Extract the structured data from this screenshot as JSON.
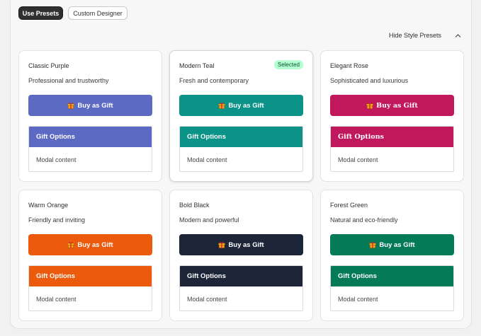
{
  "toolbar": {
    "use_presets_label": "Use Presets",
    "custom_designer_label": "Custom Designer"
  },
  "presets_header": {
    "toggle_label": "Hide Style Presets",
    "toggle_icon": "chevron-up-icon"
  },
  "presets": [
    {
      "name": "Classic Purple",
      "description": "Professional and trustworthy",
      "button_label": "Buy as Gift",
      "modal_title": "Gift Options",
      "modal_body": "Modal content",
      "color": "#5c6ac4",
      "selected": false,
      "serif": false
    },
    {
      "name": "Modern Teal",
      "description": "Fresh and contemporary",
      "button_label": "Buy as Gift",
      "modal_title": "Gift Options",
      "modal_body": "Modal content",
      "color": "#0a9386",
      "selected": true,
      "badge": "Selected",
      "serif": false
    },
    {
      "name": "Elegant Rose",
      "description": "Sophisticated and luxurious",
      "button_label": "Buy as Gift",
      "modal_title": "Gift Options",
      "modal_body": "Modal content",
      "color": "#c0175d",
      "selected": false,
      "serif": true
    },
    {
      "name": "Warm Orange",
      "description": "Friendly and inviting",
      "button_label": "Buy as Gift",
      "modal_title": "Gift Options",
      "modal_body": "Modal content",
      "color": "#ec5a0d",
      "selected": false,
      "serif": false
    },
    {
      "name": "Bold Black",
      "description": "Modern and powerful",
      "button_label": "Buy as Gift",
      "modal_title": "Gift Options",
      "modal_body": "Modal content",
      "color": "#1c2638",
      "selected": false,
      "serif": false
    },
    {
      "name": "Forest Green",
      "description": "Natural and eco-friendly",
      "button_label": "Buy as Gift",
      "modal_title": "Gift Options",
      "modal_body": "Modal content",
      "color": "#057a56",
      "selected": false,
      "serif": false
    }
  ],
  "icons": {
    "gift": "gift-icon"
  }
}
